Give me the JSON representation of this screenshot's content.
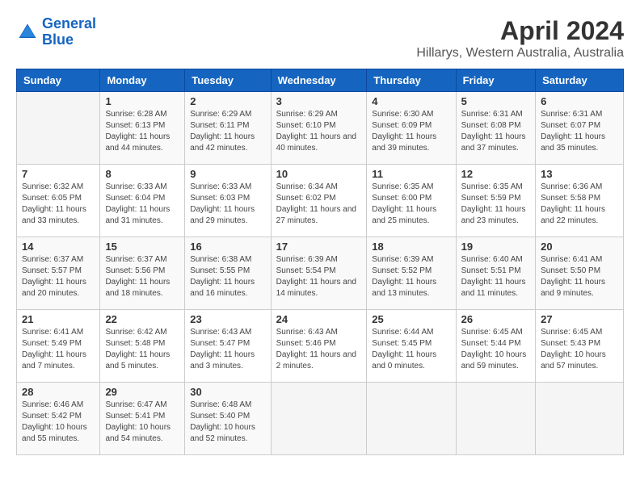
{
  "header": {
    "logo_line1": "General",
    "logo_line2": "Blue",
    "month": "April 2024",
    "location": "Hillarys, Western Australia, Australia"
  },
  "weekdays": [
    "Sunday",
    "Monday",
    "Tuesday",
    "Wednesday",
    "Thursday",
    "Friday",
    "Saturday"
  ],
  "weeks": [
    [
      {
        "day": "",
        "sunrise": "",
        "sunset": "",
        "daylight": ""
      },
      {
        "day": "1",
        "sunrise": "Sunrise: 6:28 AM",
        "sunset": "Sunset: 6:13 PM",
        "daylight": "Daylight: 11 hours and 44 minutes."
      },
      {
        "day": "2",
        "sunrise": "Sunrise: 6:29 AM",
        "sunset": "Sunset: 6:11 PM",
        "daylight": "Daylight: 11 hours and 42 minutes."
      },
      {
        "day": "3",
        "sunrise": "Sunrise: 6:29 AM",
        "sunset": "Sunset: 6:10 PM",
        "daylight": "Daylight: 11 hours and 40 minutes."
      },
      {
        "day": "4",
        "sunrise": "Sunrise: 6:30 AM",
        "sunset": "Sunset: 6:09 PM",
        "daylight": "Daylight: 11 hours and 39 minutes."
      },
      {
        "day": "5",
        "sunrise": "Sunrise: 6:31 AM",
        "sunset": "Sunset: 6:08 PM",
        "daylight": "Daylight: 11 hours and 37 minutes."
      },
      {
        "day": "6",
        "sunrise": "Sunrise: 6:31 AM",
        "sunset": "Sunset: 6:07 PM",
        "daylight": "Daylight: 11 hours and 35 minutes."
      }
    ],
    [
      {
        "day": "7",
        "sunrise": "Sunrise: 6:32 AM",
        "sunset": "Sunset: 6:05 PM",
        "daylight": "Daylight: 11 hours and 33 minutes."
      },
      {
        "day": "8",
        "sunrise": "Sunrise: 6:33 AM",
        "sunset": "Sunset: 6:04 PM",
        "daylight": "Daylight: 11 hours and 31 minutes."
      },
      {
        "day": "9",
        "sunrise": "Sunrise: 6:33 AM",
        "sunset": "Sunset: 6:03 PM",
        "daylight": "Daylight: 11 hours and 29 minutes."
      },
      {
        "day": "10",
        "sunrise": "Sunrise: 6:34 AM",
        "sunset": "Sunset: 6:02 PM",
        "daylight": "Daylight: 11 hours and 27 minutes."
      },
      {
        "day": "11",
        "sunrise": "Sunrise: 6:35 AM",
        "sunset": "Sunset: 6:00 PM",
        "daylight": "Daylight: 11 hours and 25 minutes."
      },
      {
        "day": "12",
        "sunrise": "Sunrise: 6:35 AM",
        "sunset": "Sunset: 5:59 PM",
        "daylight": "Daylight: 11 hours and 23 minutes."
      },
      {
        "day": "13",
        "sunrise": "Sunrise: 6:36 AM",
        "sunset": "Sunset: 5:58 PM",
        "daylight": "Daylight: 11 hours and 22 minutes."
      }
    ],
    [
      {
        "day": "14",
        "sunrise": "Sunrise: 6:37 AM",
        "sunset": "Sunset: 5:57 PM",
        "daylight": "Daylight: 11 hours and 20 minutes."
      },
      {
        "day": "15",
        "sunrise": "Sunrise: 6:37 AM",
        "sunset": "Sunset: 5:56 PM",
        "daylight": "Daylight: 11 hours and 18 minutes."
      },
      {
        "day": "16",
        "sunrise": "Sunrise: 6:38 AM",
        "sunset": "Sunset: 5:55 PM",
        "daylight": "Daylight: 11 hours and 16 minutes."
      },
      {
        "day": "17",
        "sunrise": "Sunrise: 6:39 AM",
        "sunset": "Sunset: 5:54 PM",
        "daylight": "Daylight: 11 hours and 14 minutes."
      },
      {
        "day": "18",
        "sunrise": "Sunrise: 6:39 AM",
        "sunset": "Sunset: 5:52 PM",
        "daylight": "Daylight: 11 hours and 13 minutes."
      },
      {
        "day": "19",
        "sunrise": "Sunrise: 6:40 AM",
        "sunset": "Sunset: 5:51 PM",
        "daylight": "Daylight: 11 hours and 11 minutes."
      },
      {
        "day": "20",
        "sunrise": "Sunrise: 6:41 AM",
        "sunset": "Sunset: 5:50 PM",
        "daylight": "Daylight: 11 hours and 9 minutes."
      }
    ],
    [
      {
        "day": "21",
        "sunrise": "Sunrise: 6:41 AM",
        "sunset": "Sunset: 5:49 PM",
        "daylight": "Daylight: 11 hours and 7 minutes."
      },
      {
        "day": "22",
        "sunrise": "Sunrise: 6:42 AM",
        "sunset": "Sunset: 5:48 PM",
        "daylight": "Daylight: 11 hours and 5 minutes."
      },
      {
        "day": "23",
        "sunrise": "Sunrise: 6:43 AM",
        "sunset": "Sunset: 5:47 PM",
        "daylight": "Daylight: 11 hours and 3 minutes."
      },
      {
        "day": "24",
        "sunrise": "Sunrise: 6:43 AM",
        "sunset": "Sunset: 5:46 PM",
        "daylight": "Daylight: 11 hours and 2 minutes."
      },
      {
        "day": "25",
        "sunrise": "Sunrise: 6:44 AM",
        "sunset": "Sunset: 5:45 PM",
        "daylight": "Daylight: 11 hours and 0 minutes."
      },
      {
        "day": "26",
        "sunrise": "Sunrise: 6:45 AM",
        "sunset": "Sunset: 5:44 PM",
        "daylight": "Daylight: 10 hours and 59 minutes."
      },
      {
        "day": "27",
        "sunrise": "Sunrise: 6:45 AM",
        "sunset": "Sunset: 5:43 PM",
        "daylight": "Daylight: 10 hours and 57 minutes."
      }
    ],
    [
      {
        "day": "28",
        "sunrise": "Sunrise: 6:46 AM",
        "sunset": "Sunset: 5:42 PM",
        "daylight": "Daylight: 10 hours and 55 minutes."
      },
      {
        "day": "29",
        "sunrise": "Sunrise: 6:47 AM",
        "sunset": "Sunset: 5:41 PM",
        "daylight": "Daylight: 10 hours and 54 minutes."
      },
      {
        "day": "30",
        "sunrise": "Sunrise: 6:48 AM",
        "sunset": "Sunset: 5:40 PM",
        "daylight": "Daylight: 10 hours and 52 minutes."
      },
      {
        "day": "",
        "sunrise": "",
        "sunset": "",
        "daylight": ""
      },
      {
        "day": "",
        "sunrise": "",
        "sunset": "",
        "daylight": ""
      },
      {
        "day": "",
        "sunrise": "",
        "sunset": "",
        "daylight": ""
      },
      {
        "day": "",
        "sunrise": "",
        "sunset": "",
        "daylight": ""
      }
    ]
  ]
}
